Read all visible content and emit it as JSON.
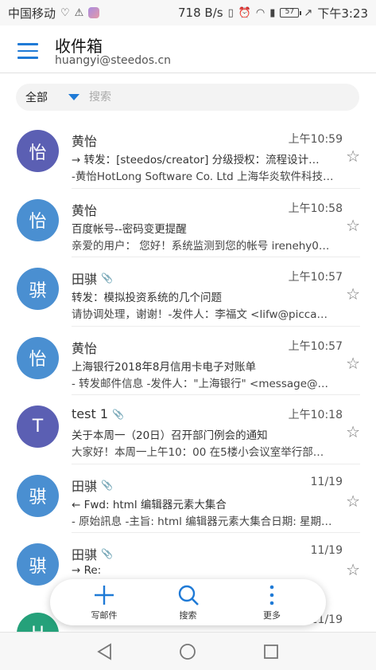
{
  "status_bar": {
    "carrier": "中国移动",
    "speed": "718 B/s",
    "battery": "57",
    "time": "下午3:23"
  },
  "header": {
    "title": "收件箱",
    "account": "huangyi@steedos.cn"
  },
  "search": {
    "filter_label": "全部",
    "placeholder": "搜索"
  },
  "mails": [
    {
      "initial": "怡",
      "avatar_color": "#5b5fb3",
      "sender": "黄怡",
      "attachment": false,
      "time": "上午10:59",
      "subject": "→ 转发：[steedos/creator] 分级授权：流程设计…",
      "preview": "-黄怡HotLong Software Co. Ltd 上海华炎软件科技…"
    },
    {
      "initial": "怡",
      "avatar_color": "#4a8fd1",
      "sender": "黄怡",
      "attachment": false,
      "time": "上午10:58",
      "subject": "百度帐号--密码变更提醒",
      "preview": "亲爱的用户： 您好！系统监测到您的帐号 irenehy0…"
    },
    {
      "initial": "骐",
      "avatar_color": "#4a8fd1",
      "sender": "田骐",
      "attachment": true,
      "time": "上午10:57",
      "subject": "转发：模拟投资系统的几个问题",
      "preview": "请协调处理，谢谢！-发件人：李福文 <lifw@picca…"
    },
    {
      "initial": "怡",
      "avatar_color": "#4a8fd1",
      "sender": "黄怡",
      "attachment": false,
      "time": "上午10:57",
      "subject": "上海银行2018年8月信用卡电子对账单",
      "preview": "- 转发邮件信息 -发件人：\"上海银行\" <message@s…"
    },
    {
      "initial": "T",
      "avatar_color": "#5b5fb3",
      "sender": "test 1",
      "attachment": true,
      "time": "上午10:18",
      "subject": "关于本周一（20日）召开部门例会的通知",
      "preview": "大家好！本周一上午10：00 在5楼小会议室举行部…"
    },
    {
      "initial": "骐",
      "avatar_color": "#4a8fd1",
      "sender": "田骐",
      "attachment": true,
      "time": "11/19",
      "subject": "← Fwd: html 编辑器元素大集合",
      "preview": "- 原始訊息 -主旨: html 编辑器元素大集合日期: 星期…"
    },
    {
      "initial": "骐",
      "avatar_color": "#4a8fd1",
      "sender": "田骐",
      "attachment": true,
      "time": "11/19",
      "subject": "→ Re:",
      "preview": ""
    },
    {
      "initial": "H",
      "avatar_color": "#25a17a",
      "sender": "",
      "attachment": false,
      "time": "11/19",
      "subject": "",
      "preview": ""
    }
  ],
  "actions": {
    "compose": "写邮件",
    "search": "搜索",
    "more": "更多"
  }
}
